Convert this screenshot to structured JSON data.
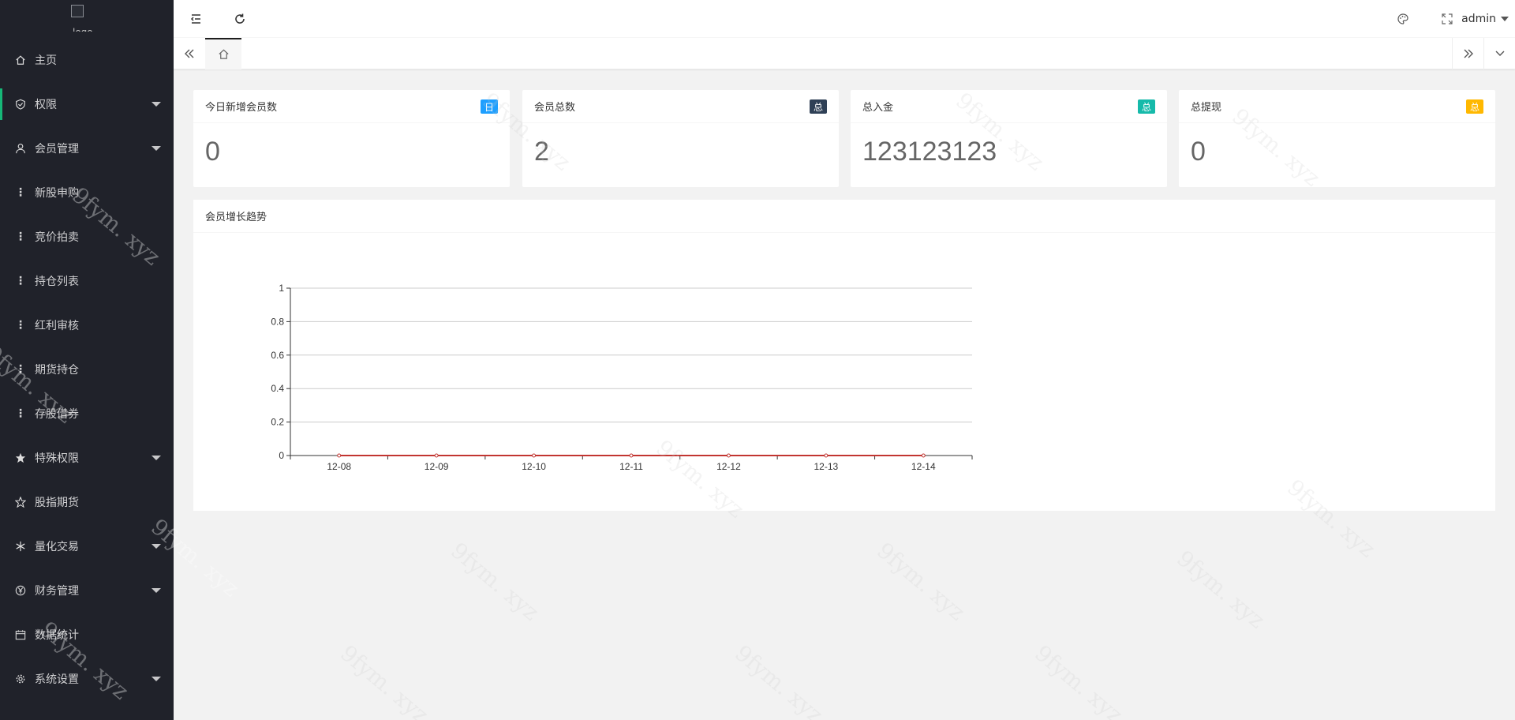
{
  "logo_alt": "logo",
  "sidebar": {
    "items": [
      {
        "label": "主页",
        "icon": "home-icon",
        "caret": false
      },
      {
        "label": "权限",
        "icon": "shield-icon",
        "caret": true
      },
      {
        "label": "会员管理",
        "icon": "user-icon",
        "caret": true
      },
      {
        "label": "新股申购",
        "icon": "dots-icon",
        "caret": false
      },
      {
        "label": "竞价拍卖",
        "icon": "dots-icon",
        "caret": false
      },
      {
        "label": "持仓列表",
        "icon": "dots-icon",
        "caret": false
      },
      {
        "label": "红利审核",
        "icon": "dots-icon",
        "caret": false
      },
      {
        "label": "期货持仓",
        "icon": "dots-icon",
        "caret": false
      },
      {
        "label": "存股借券",
        "icon": "dots-icon",
        "caret": false
      },
      {
        "label": "特殊权限",
        "icon": "star-filled-icon",
        "caret": true
      },
      {
        "label": "股指期货",
        "icon": "star-outline-icon",
        "caret": false
      },
      {
        "label": "量化交易",
        "icon": "snowflake-icon",
        "caret": true
      },
      {
        "label": "财务管理",
        "icon": "yen-icon",
        "caret": true
      },
      {
        "label": "数据统计",
        "icon": "calendar-icon",
        "caret": false
      },
      {
        "label": "系统设置",
        "icon": "gear-icon",
        "caret": true
      }
    ]
  },
  "header": {
    "user": "admin"
  },
  "stats": [
    {
      "title": "今日新增会员数",
      "badge": "日",
      "badge_color": "#1e9fff",
      "value": "0"
    },
    {
      "title": "会员总数",
      "badge": "总",
      "badge_color": "#2f4056",
      "value": "2"
    },
    {
      "title": "总入金",
      "badge": "总",
      "badge_color": "#16baaa",
      "value": "123123123"
    },
    {
      "title": "总提现",
      "badge": "总",
      "badge_color": "#ffb800",
      "value": "0"
    }
  ],
  "chart_card": {
    "title": "会员增长趋势"
  },
  "chart_data": {
    "type": "line",
    "categories": [
      "12-08",
      "12-09",
      "12-10",
      "12-11",
      "12-12",
      "12-13",
      "12-14"
    ],
    "series": [
      {
        "values": [
          0,
          0,
          0,
          0,
          0,
          0,
          0
        ]
      }
    ],
    "y_ticks": [
      "0",
      "0.2",
      "0.4",
      "0.6",
      "0.8",
      "1"
    ],
    "ylim": [
      0,
      1
    ],
    "grid": true,
    "color": "#c23531"
  },
  "watermark_text": "9fym. xyz"
}
